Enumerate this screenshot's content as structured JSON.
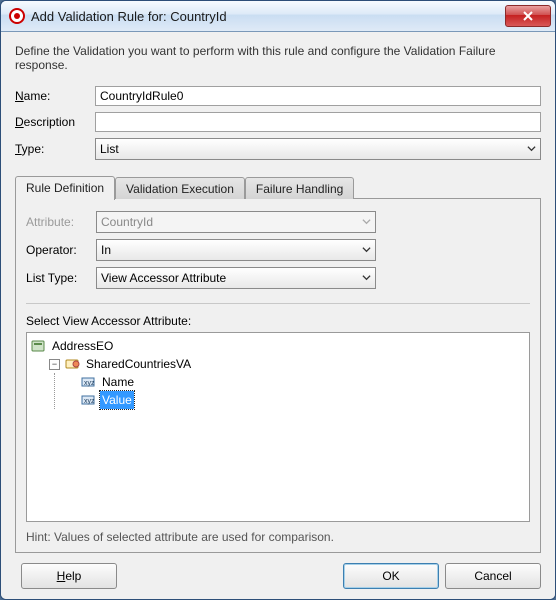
{
  "window": {
    "title": "Add Validation Rule for: CountryId",
    "intro": "Define the Validation you want to perform with this rule and configure the Validation Failure response."
  },
  "form": {
    "name_label_pre": "N",
    "name_label_post": "ame:",
    "name_value": "CountryIdRule0",
    "desc_label_pre": "D",
    "desc_label_post": "escription",
    "desc_value": "",
    "type_label_pre": "T",
    "type_label_post": "ype:",
    "type_value": "List"
  },
  "tabs": {
    "definition": "Rule Definition",
    "execution": "Validation Execution",
    "failure": "Failure Handling"
  },
  "panel": {
    "attribute_label_pre": "Attri",
    "attribute_label_u": "b",
    "attribute_label_post": "ute:",
    "attribute_value": "CountryId",
    "operator_label_pre": "O",
    "operator_label_post": "perator:",
    "operator_value": "In",
    "listtype_label_pre": "L",
    "listtype_label_post": "ist Type:",
    "listtype_value": "View Accessor Attribute",
    "section_label": "Select View Accessor Attribute:",
    "hint": "Hint: Values of selected attribute are used for comparison."
  },
  "tree": {
    "root": "AddressEO",
    "child": "SharedCountriesVA",
    "leaf1": "Name",
    "leaf2": "Value"
  },
  "footer": {
    "help_pre": "H",
    "help_post": "elp",
    "ok": "OK",
    "cancel": "Cancel"
  }
}
